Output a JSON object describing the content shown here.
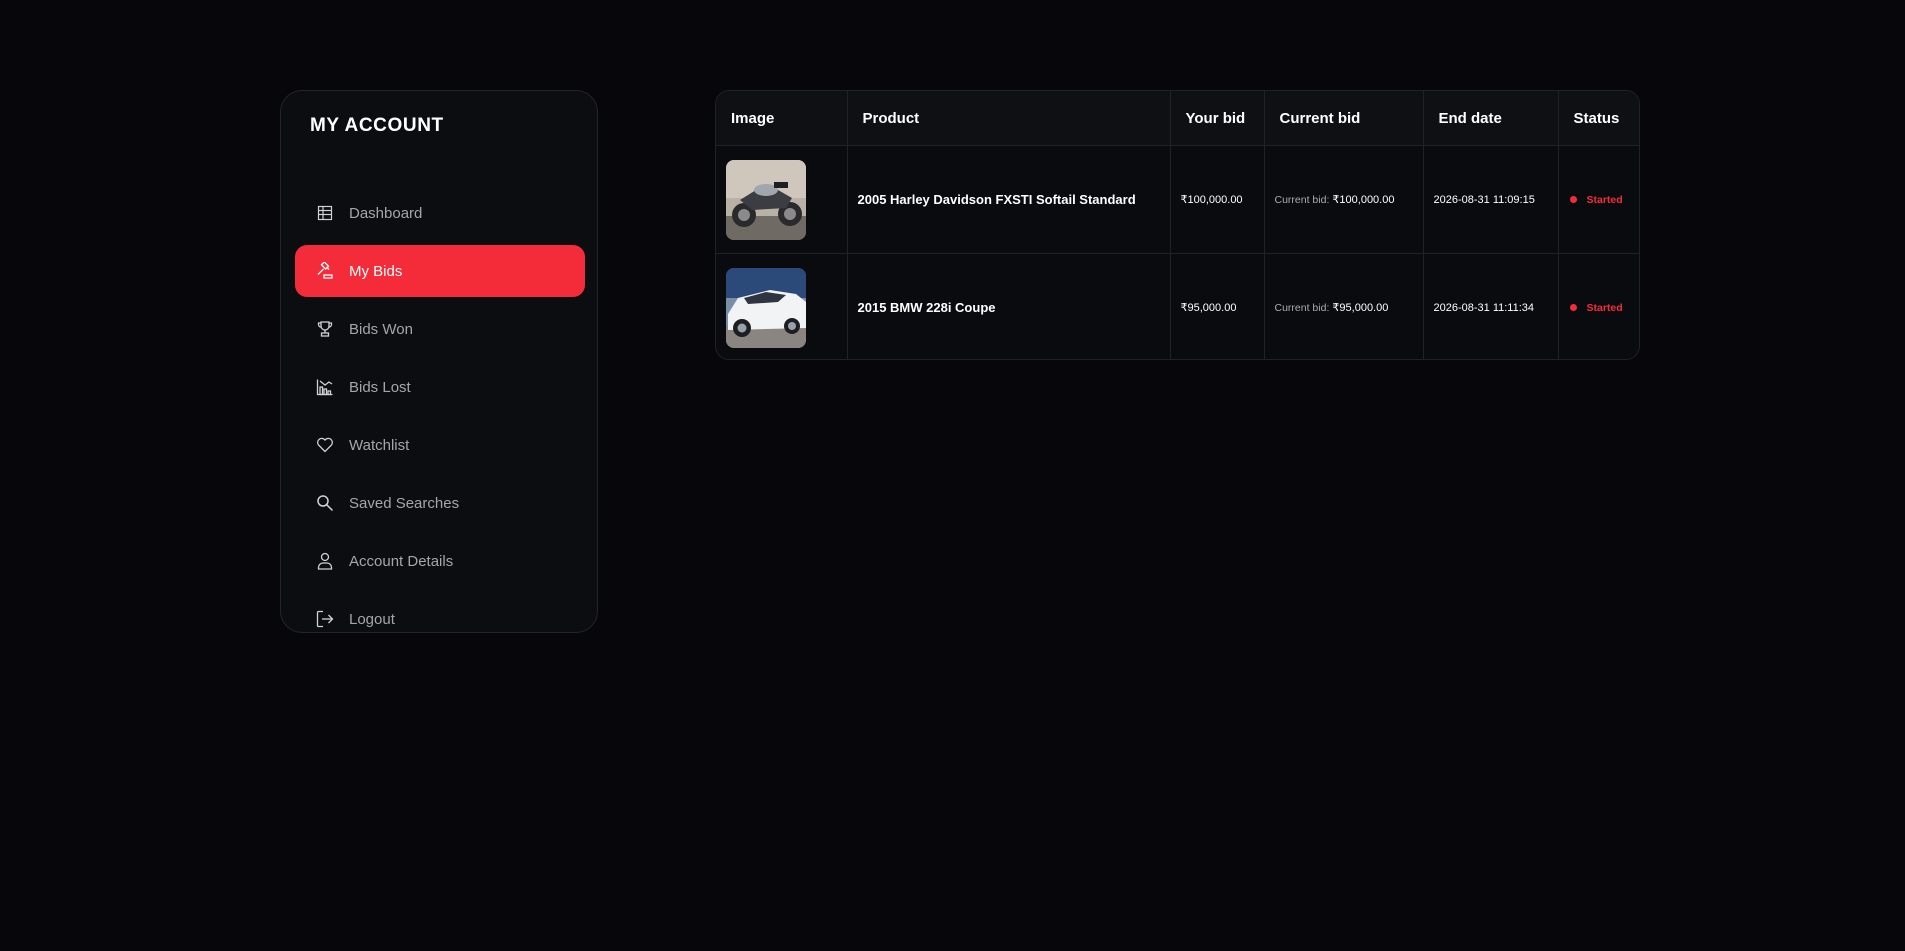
{
  "sidebar": {
    "title": "MY ACCOUNT",
    "items": [
      {
        "label": "Dashboard",
        "icon": "dashboard-icon",
        "active": false
      },
      {
        "label": "My Bids",
        "icon": "gavel-icon",
        "active": true
      },
      {
        "label": "Bids Won",
        "icon": "trophy-icon",
        "active": false
      },
      {
        "label": "Bids Lost",
        "icon": "chart-down-icon",
        "active": false
      },
      {
        "label": "Watchlist",
        "icon": "heart-icon",
        "active": false
      },
      {
        "label": "Saved Searches",
        "icon": "search-icon",
        "active": false
      },
      {
        "label": "Account Details",
        "icon": "user-icon",
        "active": false
      },
      {
        "label": "Logout",
        "icon": "logout-icon",
        "active": false
      }
    ]
  },
  "table": {
    "headers": [
      "Image",
      "Product",
      "Your bid",
      "Current bid",
      "End date",
      "Status"
    ],
    "rows": [
      {
        "image": "motorcycle-thumbnail",
        "product": "2005 Harley Davidson FXSTI Softail Standard",
        "your_bid": "₹100,000.00",
        "current_bid_label": "Current bid:",
        "current_bid_value": " ₹100,000.00",
        "end_date": "2026-08-31 11:09:15",
        "status": "Started"
      },
      {
        "image": "car-thumbnail",
        "product": "2015 BMW 228i Coupe",
        "your_bid": "₹95,000.00",
        "current_bid_label": "Current bid:",
        "current_bid_value": " ₹95,000.00",
        "end_date": "2026-08-31 11:11:34",
        "status": "Started"
      }
    ]
  },
  "colors": {
    "background": "#07070b",
    "accent": "#f42c3a",
    "panel": "#0b0d11"
  }
}
